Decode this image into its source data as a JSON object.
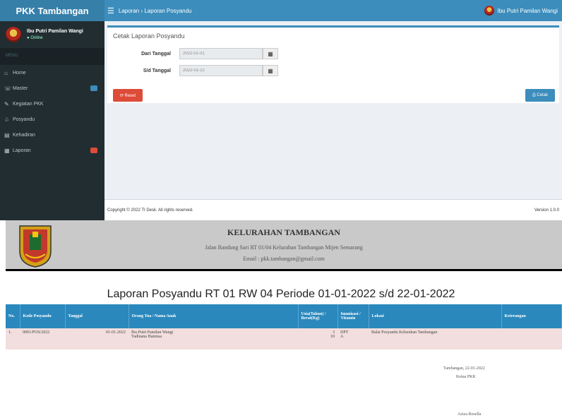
{
  "app": {
    "brand": "PKK Tambangan",
    "breadcrumb": "Laporan › Laporan Posyandu",
    "user_name": "Ibu Putri Pamilan Wangi"
  },
  "sidebar": {
    "user_name": "Ibu Putri Pamilan Wangi",
    "user_status": "● Online",
    "header": "MENU",
    "items": [
      {
        "icon": "⌂",
        "label": "Home",
        "badge_color": ""
      },
      {
        "icon": "☏",
        "label": "Master",
        "badge_color": "#3c8dbc"
      },
      {
        "icon": "✎",
        "label": "Kegiatan PKK",
        "badge_color": ""
      },
      {
        "icon": "♧",
        "label": "Posyandu",
        "badge_color": ""
      },
      {
        "icon": "▤",
        "label": "Kehadiran",
        "badge_color": ""
      },
      {
        "icon": "▦",
        "label": "Laporan",
        "badge_color": "#dd4b39"
      }
    ]
  },
  "form": {
    "title": "Cetak Laporan Posyandu",
    "from_label": "Dari Tanggal",
    "from_value": "2022-01-01",
    "to_label": "S/d Tanggal",
    "to_value": "2022-01-22",
    "reset_label": "⟳ Reset",
    "print_label": "⎙ Cetak"
  },
  "footer": {
    "copyright": "Copyright © 2022 TI Desk. All rights reserved.",
    "version": "Version 1.0.0"
  },
  "report": {
    "kelurahan": "KELURAHAN TAMBANGAN",
    "address": "Jalan Bandung Sari RT 01/04 Kelurahan Tambangan Mijen Semarang",
    "email": "Email : pkk.tambangan@gmail.com",
    "title": "Laporan Posyandu RT 01 RW 04 Periode 01-01-2022 s/d 22-01-2022",
    "columns": [
      "No.",
      "Kode Posyandu",
      "Tanggal",
      "Orang Tua / Nama Anak",
      "Usia(Tahun) / Berat(Kg)",
      "Imunisasi / Vitamin",
      "Lokasi",
      "Keterangan"
    ],
    "rows": [
      {
        "no": "1.",
        "kode": "0001/POS/2022",
        "tanggal": "01-01-2022",
        "ortu": "Ibu Putri Pamilan Wangi",
        "anak": "Tadinana Hanmsa",
        "usia": "3",
        "berat": "10",
        "imunisasi": "DPT",
        "vitamin": "A",
        "lokasi": "Balai Posyandu Kelurahan Tambangan",
        "keterangan": ""
      }
    ],
    "place_date": "Tambangan, 22-01-2022",
    "signer_title": "Ketua PKK",
    "signer_name": "Aziza Rosella"
  }
}
